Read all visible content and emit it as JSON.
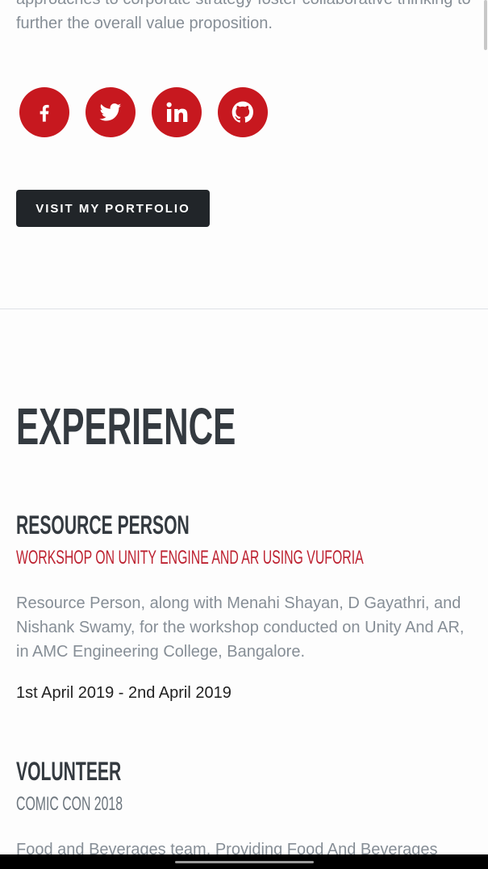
{
  "intro": {
    "text": "approaches to corporate strategy foster collaborative thinking to further the overall value proposition."
  },
  "social": {
    "color": "#c7181f",
    "icons": [
      "facebook-icon",
      "twitter-icon",
      "linkedin-icon",
      "github-icon"
    ]
  },
  "portfolio_button": {
    "label": "VISIT MY PORTFOLIO"
  },
  "experience": {
    "title": "EXPERIENCE",
    "items": [
      {
        "title": "RESOURCE PERSON",
        "subtitle": "WORKSHOP ON UNITY ENGINE AND AR USING VUFORIA",
        "description": "Resource Person, along with Menahi Shayan, D Gayathri, and Nishank Swamy, for the workshop conducted on Unity And AR, in AMC Engineering College, Bangalore.",
        "date": "1st April 2019 - 2nd April 2019"
      },
      {
        "title": "VOLUNTEER",
        "subtitle": "COMIC CON 2018",
        "description": "Food and Beverages team. Providing Food And Beverages"
      }
    ]
  }
}
